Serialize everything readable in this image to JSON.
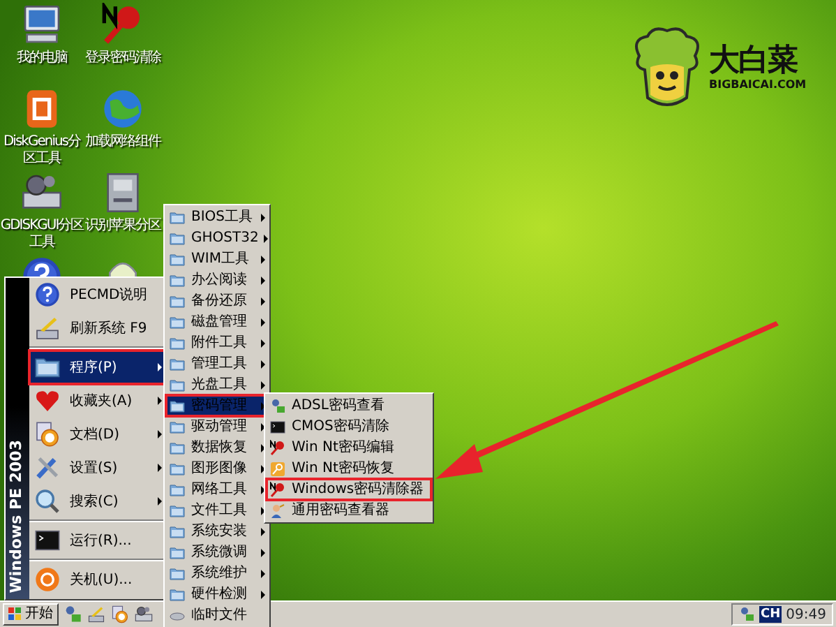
{
  "desktop_icons": [
    {
      "label": "我的电脑"
    },
    {
      "label": "登录密码清除"
    },
    {
      "label": "DiskGenius分区工具"
    },
    {
      "label": "加载网络组件"
    },
    {
      "label": "GDISKGUI分区工具"
    },
    {
      "label": "识别苹果分区"
    }
  ],
  "logo": {
    "name": "大白菜",
    "url": "BIGBAICAI.COM"
  },
  "start_menu": {
    "banner": "Windows PE 2003",
    "items": [
      {
        "kind": "item",
        "label": "PECMD说明",
        "submenu": false,
        "selected": false,
        "annotated": false
      },
      {
        "kind": "item",
        "label": "刷新系统 F9",
        "submenu": false,
        "selected": false,
        "annotated": false
      },
      {
        "kind": "separator"
      },
      {
        "kind": "item",
        "label": "程序(P)",
        "submenu": true,
        "selected": true,
        "annotated": true
      },
      {
        "kind": "item",
        "label": "收藏夹(A)",
        "submenu": true,
        "selected": false,
        "annotated": false
      },
      {
        "kind": "item",
        "label": "文档(D)",
        "submenu": true,
        "selected": false,
        "annotated": false
      },
      {
        "kind": "item",
        "label": "设置(S)",
        "submenu": true,
        "selected": false,
        "annotated": false
      },
      {
        "kind": "item",
        "label": "搜索(C)",
        "submenu": true,
        "selected": false,
        "annotated": false
      },
      {
        "kind": "separator"
      },
      {
        "kind": "item",
        "label": "运行(R)...",
        "submenu": false,
        "selected": false,
        "annotated": false
      },
      {
        "kind": "separator"
      },
      {
        "kind": "item",
        "label": "关机(U)...",
        "submenu": false,
        "selected": false,
        "annotated": false
      }
    ]
  },
  "programs_menu": {
    "items": [
      {
        "label": "BIOS工具",
        "submenu": true,
        "selected": false,
        "annotated": false
      },
      {
        "label": "GHOST32",
        "submenu": true,
        "selected": false,
        "annotated": false
      },
      {
        "label": "WIM工具",
        "submenu": true,
        "selected": false,
        "annotated": false
      },
      {
        "label": "办公阅读",
        "submenu": true,
        "selected": false,
        "annotated": false
      },
      {
        "label": "备份还原",
        "submenu": true,
        "selected": false,
        "annotated": false
      },
      {
        "label": "磁盘管理",
        "submenu": true,
        "selected": false,
        "annotated": false
      },
      {
        "label": "附件工具",
        "submenu": true,
        "selected": false,
        "annotated": false
      },
      {
        "label": "管理工具",
        "submenu": true,
        "selected": false,
        "annotated": false
      },
      {
        "label": "光盘工具",
        "submenu": true,
        "selected": false,
        "annotated": false
      },
      {
        "label": "密码管理",
        "submenu": true,
        "selected": true,
        "annotated": true
      },
      {
        "label": "驱动管理",
        "submenu": true,
        "selected": false,
        "annotated": false
      },
      {
        "label": "数据恢复",
        "submenu": true,
        "selected": false,
        "annotated": false
      },
      {
        "label": "图形图像",
        "submenu": true,
        "selected": false,
        "annotated": false
      },
      {
        "label": "网络工具",
        "submenu": true,
        "selected": false,
        "annotated": false
      },
      {
        "label": "文件工具",
        "submenu": true,
        "selected": false,
        "annotated": false
      },
      {
        "label": "系统安装",
        "submenu": true,
        "selected": false,
        "annotated": false
      },
      {
        "label": "系统微调",
        "submenu": true,
        "selected": false,
        "annotated": false
      },
      {
        "label": "系统维护",
        "submenu": true,
        "selected": false,
        "annotated": false
      },
      {
        "label": "硬件检测",
        "submenu": true,
        "selected": false,
        "annotated": false
      },
      {
        "label": "临时文件",
        "submenu": false,
        "selected": false,
        "annotated": false
      }
    ]
  },
  "password_menu": {
    "items": [
      {
        "label": "ADSL密码查看",
        "selected": false,
        "annotated": false
      },
      {
        "label": "CMOS密码清除",
        "selected": false,
        "annotated": false
      },
      {
        "label": "Win Nt密码编辑",
        "selected": false,
        "annotated": false
      },
      {
        "label": "Win Nt密码恢复",
        "selected": false,
        "annotated": false
      },
      {
        "label": "Windows密码清除器",
        "selected": false,
        "annotated": true
      },
      {
        "label": "通用密码查看器",
        "selected": false,
        "annotated": false
      }
    ]
  },
  "taskbar": {
    "start_label": "开始",
    "language": "CH",
    "clock": "09:49"
  }
}
